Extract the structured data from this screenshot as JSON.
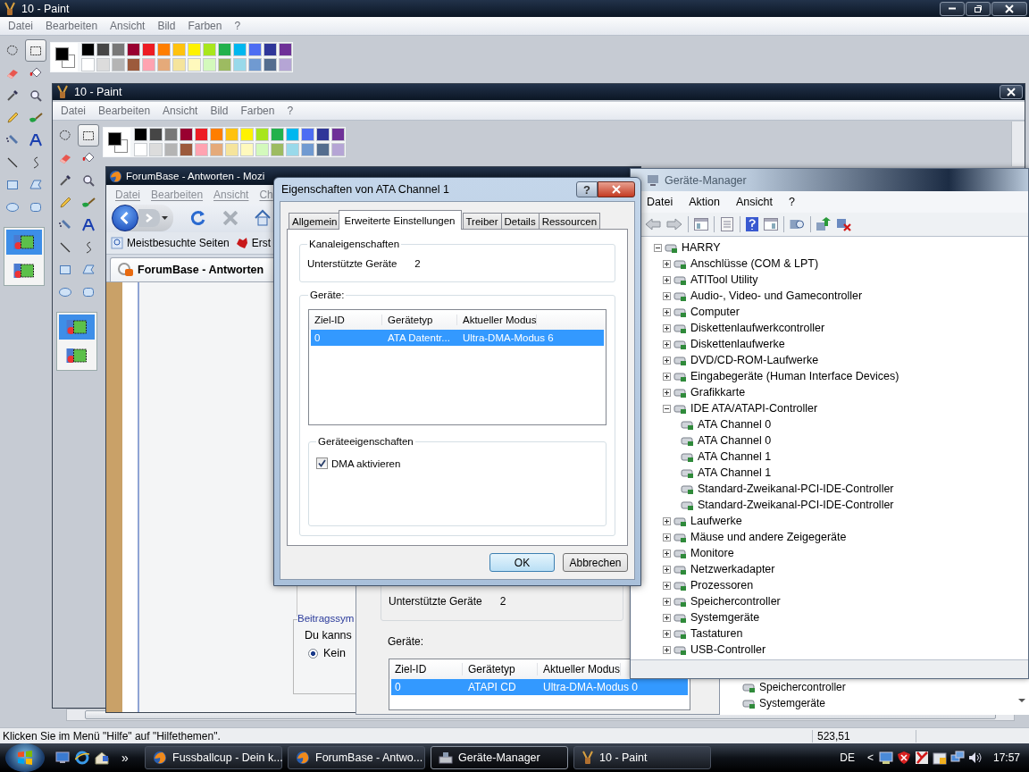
{
  "outer_paint": {
    "title": "10 - Paint",
    "menu": [
      "Datei",
      "Bearbeiten",
      "Ansicht",
      "Bild",
      "Farben",
      "?"
    ],
    "tools": [
      {
        "kind": "free-select",
        "selected": false
      },
      {
        "kind": "rect-select",
        "selected": true
      },
      {
        "kind": "eraser",
        "selected": false
      },
      {
        "kind": "fill",
        "selected": false
      },
      {
        "kind": "picker",
        "selected": false
      },
      {
        "kind": "magnifier",
        "selected": false
      },
      {
        "kind": "pencil",
        "selected": false
      },
      {
        "kind": "brush",
        "selected": false
      },
      {
        "kind": "airbrush",
        "selected": false
      },
      {
        "kind": "text",
        "selected": false
      },
      {
        "kind": "line",
        "selected": false
      },
      {
        "kind": "curve",
        "selected": false
      },
      {
        "kind": "rectangle",
        "selected": false
      },
      {
        "kind": "polygon",
        "selected": false
      },
      {
        "kind": "ellipse",
        "selected": false
      },
      {
        "kind": "rounded",
        "selected": false
      }
    ],
    "transparency": [
      {
        "selected": true
      },
      {
        "selected": false
      }
    ],
    "current_colors": [
      {
        "color": "#000000"
      },
      {
        "color": "#ffffff"
      }
    ],
    "palette": [
      {
        "color": "#000000"
      },
      {
        "color": "#464646"
      },
      {
        "color": "#787878"
      },
      {
        "color": "#990030"
      },
      {
        "color": "#ed1c24"
      },
      {
        "color": "#ff7e00"
      },
      {
        "color": "#ffc20e"
      },
      {
        "color": "#fff200"
      },
      {
        "color": "#a8e61d"
      },
      {
        "color": "#22b14c"
      },
      {
        "color": "#00b7ef"
      },
      {
        "color": "#4d6df3"
      },
      {
        "color": "#2f3699"
      },
      {
        "color": "#6f3198"
      },
      {
        "color": "#ffffff"
      },
      {
        "color": "#dcdcdc"
      },
      {
        "color": "#b4b4b4"
      },
      {
        "color": "#9c5a3c"
      },
      {
        "color": "#ffa3b1"
      },
      {
        "color": "#e5aa7a"
      },
      {
        "color": "#f5e49c"
      },
      {
        "color": "#fff9bd"
      },
      {
        "color": "#d3f9bc"
      },
      {
        "color": "#9dbb61"
      },
      {
        "color": "#99d9ea"
      },
      {
        "color": "#709ad1"
      },
      {
        "color": "#546d8e"
      },
      {
        "color": "#b5a5d5"
      }
    ],
    "status_text": "Klicken Sie im Menü \"Hilfe\" auf \"Hilfethemen\".",
    "status_coords": "523,51"
  },
  "inner_paint": {
    "title": "10 - Paint",
    "menu": [
      "Datei",
      "Bearbeiten",
      "Ansicht",
      "Bild",
      "Farben",
      "?"
    ],
    "tools": [
      {
        "kind": "free-select",
        "selected": false
      },
      {
        "kind": "rect-select",
        "selected": true
      },
      {
        "kind": "eraser",
        "selected": false
      },
      {
        "kind": "fill",
        "selected": false
      },
      {
        "kind": "picker",
        "selected": false
      },
      {
        "kind": "magnifier",
        "selected": false
      },
      {
        "kind": "pencil",
        "selected": false
      },
      {
        "kind": "brush",
        "selected": false
      },
      {
        "kind": "airbrush",
        "selected": false
      },
      {
        "kind": "text",
        "selected": false
      },
      {
        "kind": "line",
        "selected": false
      },
      {
        "kind": "curve",
        "selected": false
      },
      {
        "kind": "rectangle",
        "selected": false
      },
      {
        "kind": "polygon",
        "selected": false
      },
      {
        "kind": "ellipse",
        "selected": false
      },
      {
        "kind": "rounded",
        "selected": false
      }
    ],
    "transparency": [
      {
        "selected": true
      },
      {
        "selected": false
      }
    ],
    "current_colors": [
      {
        "color": "#000000"
      },
      {
        "color": "#ffffff"
      }
    ],
    "palette": [
      {
        "color": "#000000"
      },
      {
        "color": "#464646"
      },
      {
        "color": "#787878"
      },
      {
        "color": "#990030"
      },
      {
        "color": "#ed1c24"
      },
      {
        "color": "#ff7e00"
      },
      {
        "color": "#ffc20e"
      },
      {
        "color": "#fff200"
      },
      {
        "color": "#a8e61d"
      },
      {
        "color": "#22b14c"
      },
      {
        "color": "#00b7ef"
      },
      {
        "color": "#4d6df3"
      },
      {
        "color": "#2f3699"
      },
      {
        "color": "#6f3198"
      },
      {
        "color": "#ffffff"
      },
      {
        "color": "#dcdcdc"
      },
      {
        "color": "#b4b4b4"
      },
      {
        "color": "#9c5a3c"
      },
      {
        "color": "#ffa3b1"
      },
      {
        "color": "#e5aa7a"
      },
      {
        "color": "#f5e49c"
      },
      {
        "color": "#fff9bd"
      },
      {
        "color": "#d3f9bc"
      },
      {
        "color": "#9dbb61"
      },
      {
        "color": "#99d9ea"
      },
      {
        "color": "#709ad1"
      },
      {
        "color": "#546d8e"
      },
      {
        "color": "#b5a5d5"
      }
    ]
  },
  "firefox": {
    "title": "ForumBase - Antworten - Mozi",
    "menu": [
      "Datei",
      "Bearbeiten",
      "Ansicht",
      "Ch"
    ],
    "bookmarks": [
      "Meistbesuchte Seiten",
      "Erst"
    ],
    "tab": "ForumBase - Antworten",
    "legend": "Beitragssym",
    "text": "Du kanns",
    "radio": {
      "label": "Kein",
      "selected": true
    }
  },
  "back_dialog": {
    "supported_label": "Unterstützte Geräte",
    "supported_value": "2",
    "devices_label": "Geräte:",
    "columns": [
      "Ziel-ID",
      "Gerätetyp",
      "Aktueller Modus"
    ],
    "rows": [
      {
        "cells": [
          "0",
          "ATAPI CD",
          "Ultra-DMA-Modus 0"
        ],
        "selected": true
      }
    ]
  },
  "back_device_manager": {
    "items": [
      "Speichercontroller",
      "Systemgeräte"
    ]
  },
  "device_manager": {
    "title": "Geräte-Manager",
    "menu": [
      "Datei",
      "Aktion",
      "Ansicht",
      "?"
    ],
    "tree": {
      "label": "HARRY",
      "expanded": true,
      "children": [
        {
          "label": "Anschlüsse (COM & LPT)",
          "expanded": false
        },
        {
          "label": "ATITool Utility",
          "expanded": false
        },
        {
          "label": "Audio-, Video- und Gamecontroller",
          "expanded": false
        },
        {
          "label": "Computer",
          "expanded": false
        },
        {
          "label": "Diskettenlaufwerkcontroller",
          "expanded": false
        },
        {
          "label": "Diskettenlaufwerke",
          "expanded": false
        },
        {
          "label": "DVD/CD-ROM-Laufwerke",
          "expanded": false
        },
        {
          "label": "Eingabegeräte (Human Interface Devices)",
          "expanded": false
        },
        {
          "label": "Grafikkarte",
          "expanded": false
        },
        {
          "label": "IDE ATA/ATAPI-Controller",
          "expanded": true,
          "children": [
            {
              "label": "ATA Channel 0"
            },
            {
              "label": "ATA Channel 0"
            },
            {
              "label": "ATA Channel 1"
            },
            {
              "label": "ATA Channel 1"
            },
            {
              "label": "Standard-Zweikanal-PCI-IDE-Controller"
            },
            {
              "label": "Standard-Zweikanal-PCI-IDE-Controller"
            }
          ]
        },
        {
          "label": "Laufwerke",
          "expanded": false
        },
        {
          "label": "Mäuse und andere Zeigegeräte",
          "expanded": false
        },
        {
          "label": "Monitore",
          "expanded": false
        },
        {
          "label": "Netzwerkadapter",
          "expanded": false
        },
        {
          "label": "Prozessoren",
          "expanded": false
        },
        {
          "label": "Speichercontroller",
          "expanded": false
        },
        {
          "label": "Systemgeräte",
          "expanded": false
        },
        {
          "label": "Tastaturen",
          "expanded": false
        },
        {
          "label": "USB-Controller",
          "expanded": false
        }
      ]
    }
  },
  "dialog": {
    "title": "Eigenschaften von ATA Channel 1",
    "help_button": "?",
    "tabs": [
      {
        "label": "Allgemein",
        "selected": false
      },
      {
        "label": "Erweiterte Einstellungen",
        "selected": true
      },
      {
        "label": "Treiber",
        "selected": false
      },
      {
        "label": "Details",
        "selected": false
      },
      {
        "label": "Ressourcen",
        "selected": false
      }
    ],
    "channel_group": "Kanaleigenschaften",
    "supported_label": "Unterstützte Geräte",
    "supported_value": "2",
    "devices_group": "Geräte:",
    "columns": [
      "Ziel-ID",
      "Gerätetyp",
      "Aktueller Modus"
    ],
    "rows": [
      {
        "cells": [
          "0",
          "ATA Datentr...",
          "Ultra-DMA-Modus 6"
        ],
        "selected": true
      }
    ],
    "device_group": "Geräteeigenschaften",
    "dma": {
      "label": "DMA aktivieren",
      "checked": true
    },
    "buttons": [
      "OK",
      "Abbrechen"
    ]
  },
  "taskbar": {
    "more": "»",
    "tasks": [
      {
        "kind": "browser",
        "label": "Fussballcup - Dein k...",
        "selected": false
      },
      {
        "kind": "browser",
        "label": "ForumBase - Antwo...",
        "selected": false
      },
      {
        "kind": "device-manager",
        "label": "Geräte-Manager",
        "selected": true
      },
      {
        "kind": "paint",
        "label": "10 - Paint",
        "selected": false
      }
    ],
    "language": "DE",
    "tray_toggle": "<",
    "clock": "17:57"
  }
}
